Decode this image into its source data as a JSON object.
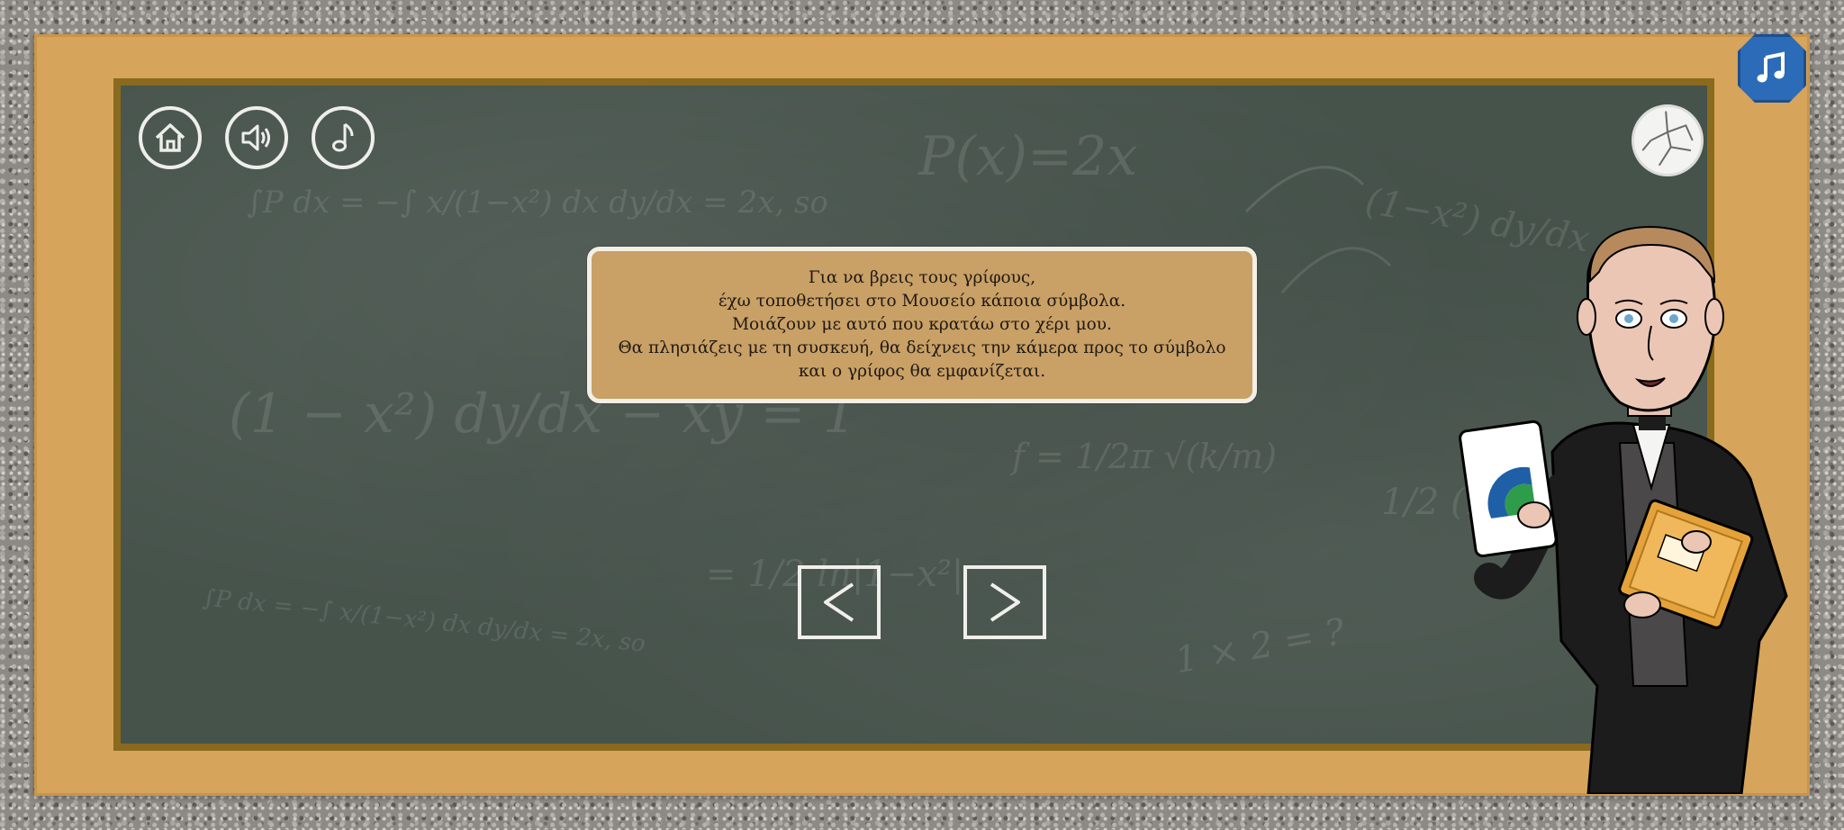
{
  "message": {
    "lines": [
      "Για να βρεις τους γρίφους,",
      "έχω τοποθετήσει στο Μουσείο κάποια σύμβολα.",
      "Μοιάζουν με αυτό που κρατάω στο χέρι μου.",
      "Θα πλησιάζεις με τη συσκευή, θα δείχνεις την κάμερα προς το σύμβολο",
      "και ο γρίφος θα εμφανίζεται."
    ]
  },
  "toolbar": {
    "home_icon": "home-icon",
    "sound_icon": "speaker-icon",
    "music_icon": "music-note-icon"
  },
  "top_right": {
    "music_badge_icon": "double-music-note-icon",
    "puzzle_icon": "cracked-puzzle-icon"
  },
  "navigation": {
    "prev_label": "<",
    "next_label": ">"
  },
  "chalk_doodles": {
    "formula_1": "P(x)=2x",
    "formula_2": "∫P dx = −∫ x/(1−x²) dx   dy/dx = 2x, so",
    "formula_3": "(1 − x²) dy/dx − xy = 1",
    "formula_4": "f = 1/2π √(k/m)",
    "formula_5": "= 1/2 ln|1−x²|",
    "formula_6": "∫P dx = −∫ x/(1−x²) dx   dy/dx = 2x, so",
    "formula_7": "1 × 2 = ?",
    "formula_8": "(1−x²) dy/dx − xy =",
    "formula_9": "1/2 (1 − x"
  },
  "colors": {
    "frame": "#d6a45a",
    "board": "#46534b",
    "board_border": "#8a6a1e",
    "message_bg": "#c9a066",
    "music_badge": "#2b6bb8"
  }
}
